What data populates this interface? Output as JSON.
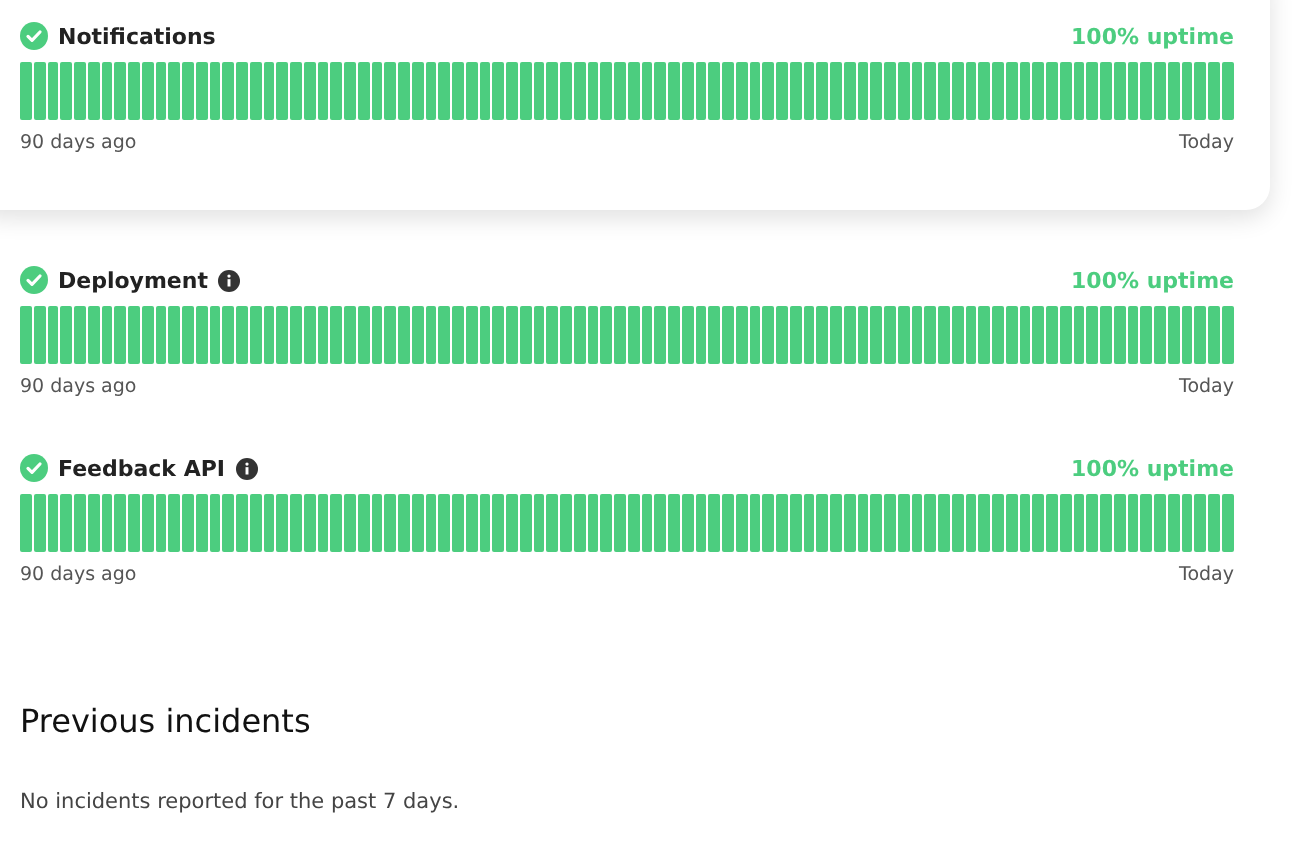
{
  "card": {
    "components": [
      {
        "name": "Notifications",
        "operational": true,
        "has_info": false,
        "uptime": "100% uptime",
        "start_label": "90 days ago",
        "end_label": "Today"
      }
    ]
  },
  "components": [
    {
      "name": "Deployment",
      "operational": true,
      "has_info": true,
      "uptime": "100% uptime",
      "start_label": "90 days ago",
      "end_label": "Today"
    },
    {
      "name": "Feedback API",
      "operational": true,
      "has_info": true,
      "uptime": "100% uptime",
      "start_label": "90 days ago",
      "end_label": "Today"
    }
  ],
  "incidents": {
    "title": "Previous incidents",
    "message": "No incidents reported for the past 7 days."
  }
}
